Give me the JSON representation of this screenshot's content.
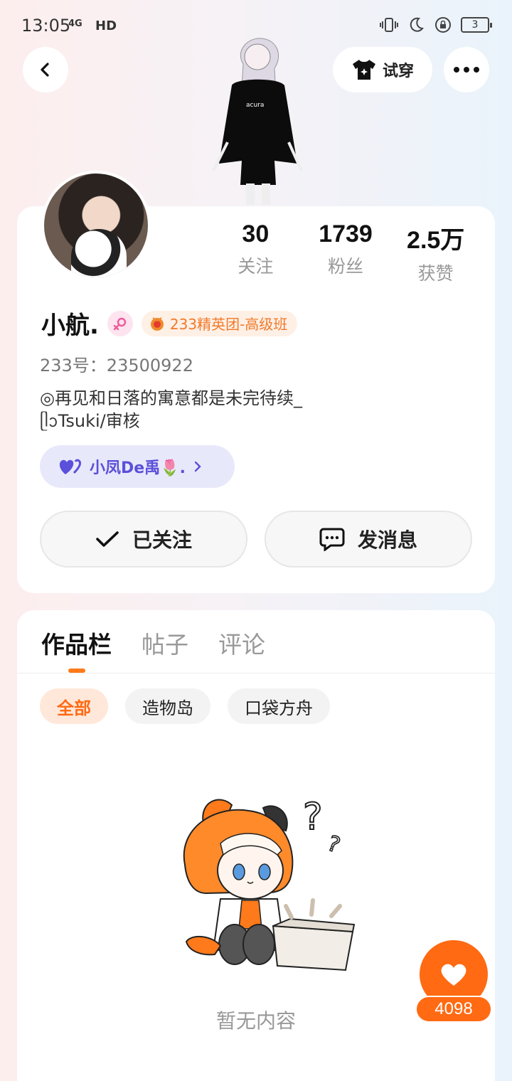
{
  "status_bar": {
    "time": "13:05",
    "network": "4G",
    "hd": "HD",
    "battery": "3"
  },
  "header": {
    "try_on_label": "试穿"
  },
  "profile": {
    "stats": [
      {
        "value": "30",
        "label": "关注"
      },
      {
        "value": "1739",
        "label": "粉丝"
      },
      {
        "value": "2.5万",
        "label": "获赞"
      }
    ],
    "name": "小航.",
    "group_badge": "233精英团-高级班",
    "uid": "233号：23500922",
    "bio_line1": "◎再见和日落的寓意都是未完待续_",
    "bio_line2": "ᥫᩣTsuki/审核",
    "friend_pill": "小凤De禹🌷.",
    "follow_label": "已关注",
    "message_label": "发消息"
  },
  "content": {
    "tabs": [
      "作品栏",
      "帖子",
      "评论"
    ],
    "chips": [
      "全部",
      "造物岛",
      "口袋方舟"
    ],
    "empty_text": "暂无内容"
  },
  "like_fab": {
    "count": "4098"
  },
  "colors": {
    "accent": "#ff6a13",
    "friend_pill_bg": "#e8e8fb",
    "friend_pill_text": "#5b50d9"
  }
}
